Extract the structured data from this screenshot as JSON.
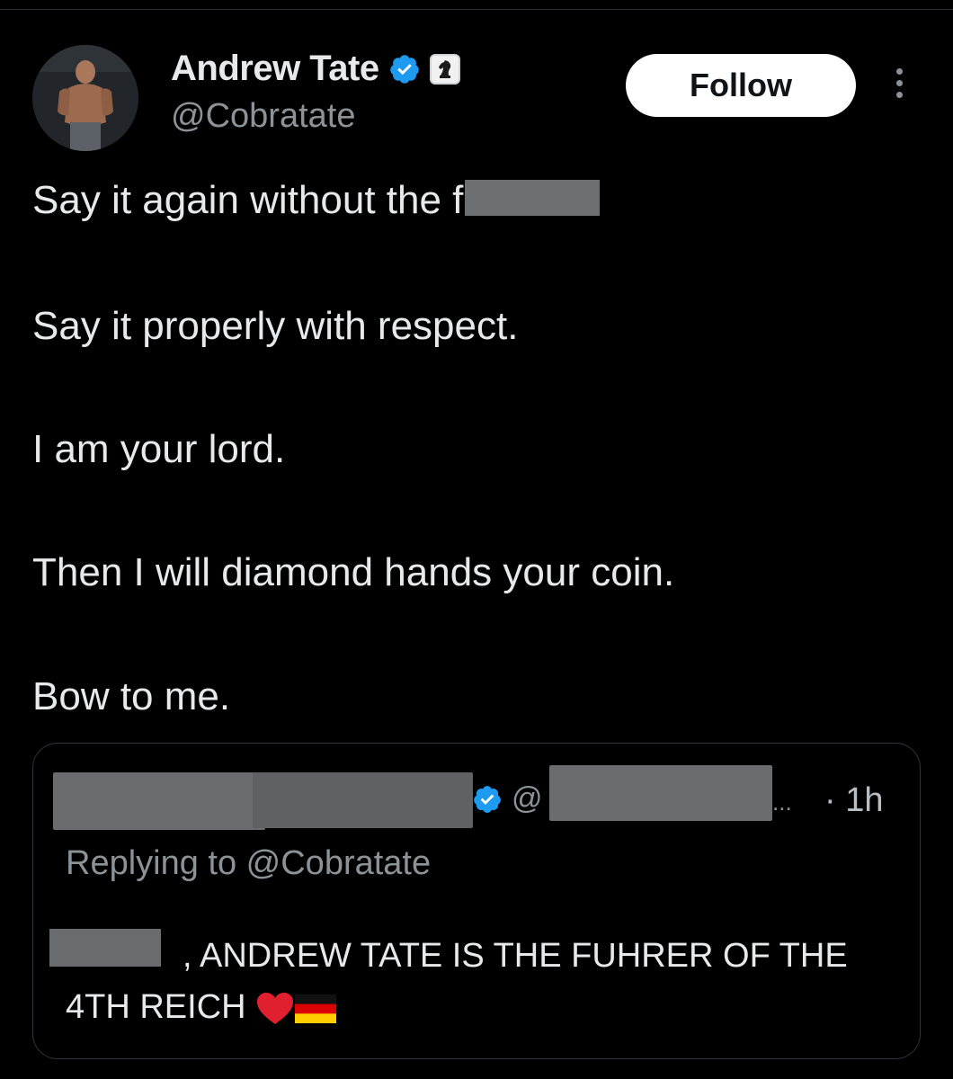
{
  "author": {
    "display_name": "Andrew Tate",
    "handle": "@Cobratate"
  },
  "follow_button": {
    "label": "Follow"
  },
  "tweet": {
    "lines": [
      "Say it again without the f",
      "Say it properly with respect.",
      "I am your lord.",
      "Then I will diamond hands your coin.",
      "Bow to me."
    ]
  },
  "quoted_tweet": {
    "at_symbol": "@",
    "ellipsis": "...",
    "time": "· 1h",
    "replying_to": "Replying to @Cobratate",
    "body_text": ", ANDREW TATE IS THE FUHRER OF THE 4TH REICH"
  },
  "icons": {
    "verified": "verified-badge-icon",
    "affiliate": "knight-affiliate-icon",
    "more": "more-options-icon",
    "heart": "heart-icon",
    "flag": "german-flag-icon"
  },
  "colors": {
    "background": "#000000",
    "text_primary": "#e7e9ea",
    "text_secondary": "#8b9399",
    "verified_blue": "#1d9bf0",
    "redaction_gray": "#6b6c6e"
  }
}
